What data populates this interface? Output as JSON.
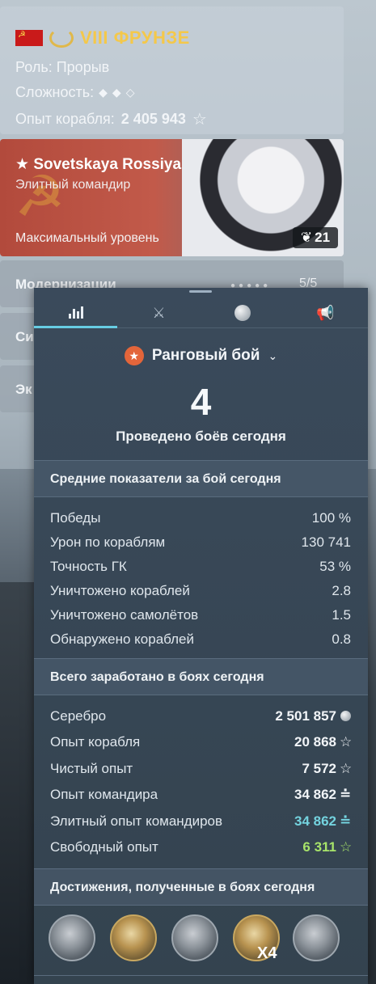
{
  "ship": {
    "tier_name": "VIII ФРУНЗЕ",
    "role_label": "Роль:",
    "role_value": "Прорыв",
    "difficulty_label": "Сложность:",
    "difficulty_level": 2,
    "difficulty_max": 3,
    "exp_label": "Опыт корабля:",
    "exp_value": "2 405 943"
  },
  "commander": {
    "name": "Sovetskaya Rossiya",
    "name_prefix": "★",
    "title": "Элитный командир",
    "level_text": "Максимальный уровень",
    "level_badge": "21"
  },
  "side_rows": [
    {
      "label": "Модернизации",
      "count": "5/5"
    },
    {
      "label": "Си"
    },
    {
      "label": "Эк"
    }
  ],
  "tabs": [
    {
      "icon": "bar-chart-icon",
      "active": true
    },
    {
      "icon": "crossed-swords-icon",
      "active": false
    },
    {
      "icon": "coins-icon",
      "active": false
    },
    {
      "icon": "megaphone-icon",
      "active": false
    }
  ],
  "mode": {
    "label": "Ранговый бой",
    "battles_count": "4",
    "battles_caption": "Проведено боёв сегодня"
  },
  "averages": {
    "title": "Средние показатели за бой сегодня",
    "rows": [
      {
        "label": "Победы",
        "value": "100 %"
      },
      {
        "label": "Урон по кораблям",
        "value": "130 741"
      },
      {
        "label": "Точность ГК",
        "value": "53 %"
      },
      {
        "label": "Уничтожено кораблей",
        "value": "2.8"
      },
      {
        "label": "Уничтожено самолётов",
        "value": "1.5"
      },
      {
        "label": "Обнаружено кораблей",
        "value": "0.8"
      }
    ]
  },
  "earned": {
    "title": "Всего заработано в боях сегодня",
    "rows": [
      {
        "label": "Серебро",
        "value": "2 501 857",
        "icon": "silver-coin-icon"
      },
      {
        "label": "Опыт корабля",
        "value": "20 868",
        "icon": "star-icon"
      },
      {
        "label": "Чистый опыт",
        "value": "7 572",
        "icon": "star-icon"
      },
      {
        "label": "Опыт командира",
        "value": "34 862",
        "icon": "commander-xp-icon"
      },
      {
        "label": "Элитный опыт командиров",
        "value": "34 862",
        "icon": "commander-xp-icon",
        "color": "#74d3df"
      },
      {
        "label": "Свободный опыт",
        "value": "6 311",
        "icon": "star-icon",
        "color": "#a7e36a"
      }
    ]
  },
  "achievements": {
    "title": "Достижения, полученные в боях сегодня",
    "items": [
      {
        "icon": "kraken-achievement-icon"
      },
      {
        "icon": "battleship-achievement-icon"
      },
      {
        "icon": "fire-achievement-icon"
      },
      {
        "icon": "main-caliber-achievement-icon",
        "multiplier": "X4"
      },
      {
        "icon": "hourglass-achievement-icon"
      }
    ]
  }
}
